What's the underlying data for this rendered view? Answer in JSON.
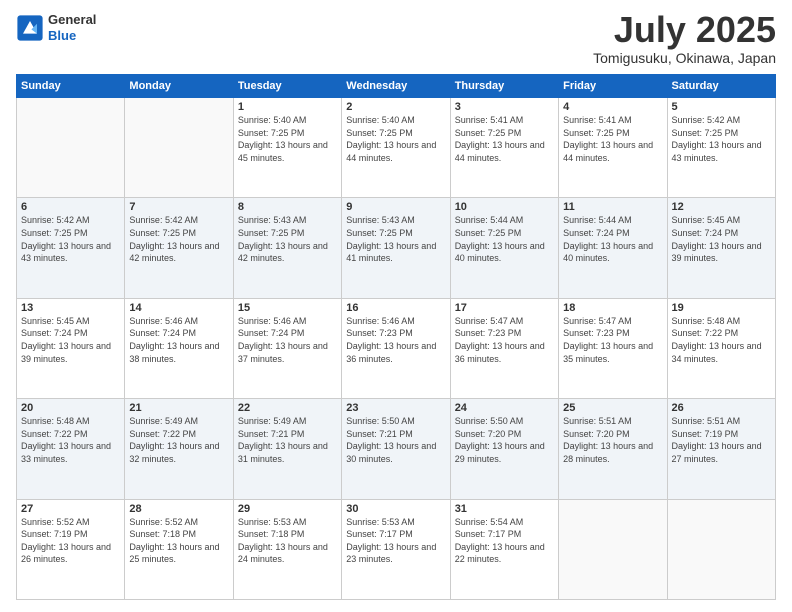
{
  "header": {
    "logo_line1": "General",
    "logo_line2": "Blue",
    "month": "July 2025",
    "location": "Tomigusuku, Okinawa, Japan"
  },
  "days_of_week": [
    "Sunday",
    "Monday",
    "Tuesday",
    "Wednesday",
    "Thursday",
    "Friday",
    "Saturday"
  ],
  "weeks": [
    [
      {
        "day": "",
        "info": ""
      },
      {
        "day": "",
        "info": ""
      },
      {
        "day": "1",
        "info": "Sunrise: 5:40 AM\nSunset: 7:25 PM\nDaylight: 13 hours and 45 minutes."
      },
      {
        "day": "2",
        "info": "Sunrise: 5:40 AM\nSunset: 7:25 PM\nDaylight: 13 hours and 44 minutes."
      },
      {
        "day": "3",
        "info": "Sunrise: 5:41 AM\nSunset: 7:25 PM\nDaylight: 13 hours and 44 minutes."
      },
      {
        "day": "4",
        "info": "Sunrise: 5:41 AM\nSunset: 7:25 PM\nDaylight: 13 hours and 44 minutes."
      },
      {
        "day": "5",
        "info": "Sunrise: 5:42 AM\nSunset: 7:25 PM\nDaylight: 13 hours and 43 minutes."
      }
    ],
    [
      {
        "day": "6",
        "info": "Sunrise: 5:42 AM\nSunset: 7:25 PM\nDaylight: 13 hours and 43 minutes."
      },
      {
        "day": "7",
        "info": "Sunrise: 5:42 AM\nSunset: 7:25 PM\nDaylight: 13 hours and 42 minutes."
      },
      {
        "day": "8",
        "info": "Sunrise: 5:43 AM\nSunset: 7:25 PM\nDaylight: 13 hours and 42 minutes."
      },
      {
        "day": "9",
        "info": "Sunrise: 5:43 AM\nSunset: 7:25 PM\nDaylight: 13 hours and 41 minutes."
      },
      {
        "day": "10",
        "info": "Sunrise: 5:44 AM\nSunset: 7:25 PM\nDaylight: 13 hours and 40 minutes."
      },
      {
        "day": "11",
        "info": "Sunrise: 5:44 AM\nSunset: 7:24 PM\nDaylight: 13 hours and 40 minutes."
      },
      {
        "day": "12",
        "info": "Sunrise: 5:45 AM\nSunset: 7:24 PM\nDaylight: 13 hours and 39 minutes."
      }
    ],
    [
      {
        "day": "13",
        "info": "Sunrise: 5:45 AM\nSunset: 7:24 PM\nDaylight: 13 hours and 39 minutes."
      },
      {
        "day": "14",
        "info": "Sunrise: 5:46 AM\nSunset: 7:24 PM\nDaylight: 13 hours and 38 minutes."
      },
      {
        "day": "15",
        "info": "Sunrise: 5:46 AM\nSunset: 7:24 PM\nDaylight: 13 hours and 37 minutes."
      },
      {
        "day": "16",
        "info": "Sunrise: 5:46 AM\nSunset: 7:23 PM\nDaylight: 13 hours and 36 minutes."
      },
      {
        "day": "17",
        "info": "Sunrise: 5:47 AM\nSunset: 7:23 PM\nDaylight: 13 hours and 36 minutes."
      },
      {
        "day": "18",
        "info": "Sunrise: 5:47 AM\nSunset: 7:23 PM\nDaylight: 13 hours and 35 minutes."
      },
      {
        "day": "19",
        "info": "Sunrise: 5:48 AM\nSunset: 7:22 PM\nDaylight: 13 hours and 34 minutes."
      }
    ],
    [
      {
        "day": "20",
        "info": "Sunrise: 5:48 AM\nSunset: 7:22 PM\nDaylight: 13 hours and 33 minutes."
      },
      {
        "day": "21",
        "info": "Sunrise: 5:49 AM\nSunset: 7:22 PM\nDaylight: 13 hours and 32 minutes."
      },
      {
        "day": "22",
        "info": "Sunrise: 5:49 AM\nSunset: 7:21 PM\nDaylight: 13 hours and 31 minutes."
      },
      {
        "day": "23",
        "info": "Sunrise: 5:50 AM\nSunset: 7:21 PM\nDaylight: 13 hours and 30 minutes."
      },
      {
        "day": "24",
        "info": "Sunrise: 5:50 AM\nSunset: 7:20 PM\nDaylight: 13 hours and 29 minutes."
      },
      {
        "day": "25",
        "info": "Sunrise: 5:51 AM\nSunset: 7:20 PM\nDaylight: 13 hours and 28 minutes."
      },
      {
        "day": "26",
        "info": "Sunrise: 5:51 AM\nSunset: 7:19 PM\nDaylight: 13 hours and 27 minutes."
      }
    ],
    [
      {
        "day": "27",
        "info": "Sunrise: 5:52 AM\nSunset: 7:19 PM\nDaylight: 13 hours and 26 minutes."
      },
      {
        "day": "28",
        "info": "Sunrise: 5:52 AM\nSunset: 7:18 PM\nDaylight: 13 hours and 25 minutes."
      },
      {
        "day": "29",
        "info": "Sunrise: 5:53 AM\nSunset: 7:18 PM\nDaylight: 13 hours and 24 minutes."
      },
      {
        "day": "30",
        "info": "Sunrise: 5:53 AM\nSunset: 7:17 PM\nDaylight: 13 hours and 23 minutes."
      },
      {
        "day": "31",
        "info": "Sunrise: 5:54 AM\nSunset: 7:17 PM\nDaylight: 13 hours and 22 minutes."
      },
      {
        "day": "",
        "info": ""
      },
      {
        "day": "",
        "info": ""
      }
    ]
  ]
}
